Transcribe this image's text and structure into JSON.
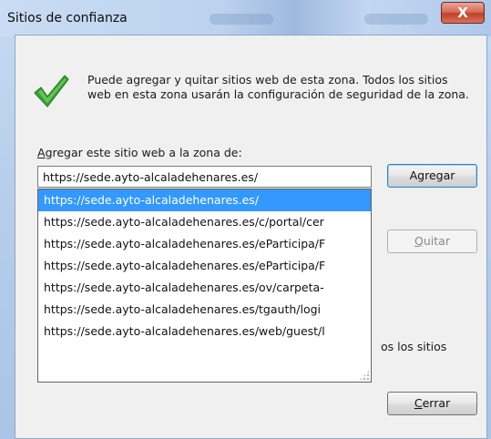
{
  "window": {
    "title": "Sitios de confianza",
    "close_glyph": "X"
  },
  "description": "Puede agregar y quitar sitios web de esta zona. Todos los sitios web en esta zona usarán la configuración de seguridad de la zona.",
  "add_site": {
    "label_accel": "A",
    "label_rest": "gregar este sitio web a la zona de:",
    "value": "https://sede.ayto-alcaladehenares.es/"
  },
  "buttons": {
    "add": "Agregar",
    "remove_accel": "Q",
    "remove_rest": "uitar",
    "close_accel": "C",
    "close_rest": "errar"
  },
  "suggestions": [
    "https://sede.ayto-alcaladehenares.es/",
    "https://sede.ayto-alcaladehenares.es/c/portal/cer",
    "https://sede.ayto-alcaladehenares.es/eParticipa/F",
    "https://sede.ayto-alcaladehenares.es/eParticipa/F",
    "https://sede.ayto-alcaladehenares.es/ov/carpeta-",
    "https://sede.ayto-alcaladehenares.es/tgauth/logi",
    "https://sede.ayto-alcaladehenares.es/web/guest/l"
  ],
  "partially_hidden_text": "os los sitios",
  "icons": {
    "status": "checkmark-icon",
    "close": "close-icon"
  },
  "colors": {
    "selection": "#3399ff",
    "check_green": "#3aa335"
  }
}
